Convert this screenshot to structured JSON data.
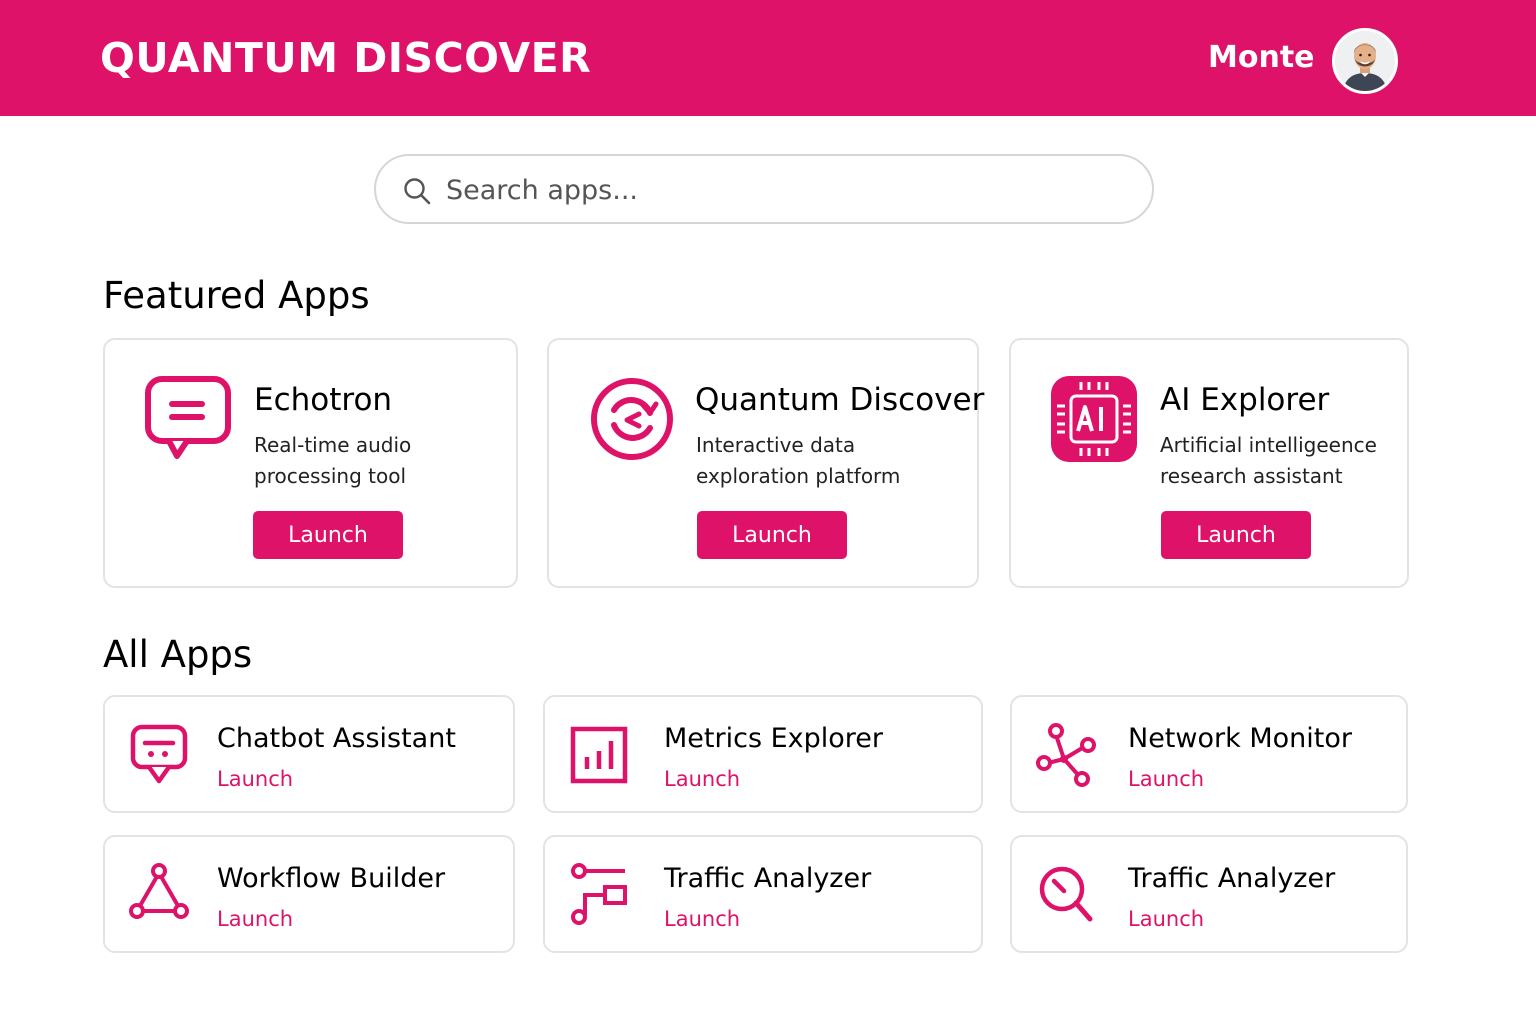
{
  "header": {
    "brand": "QUANTUM DISCOVER",
    "user_name": "Monte",
    "accent_color": "#dd1268"
  },
  "search": {
    "placeholder": "Search apps..."
  },
  "featured": {
    "title": "Featured Apps",
    "apps": [
      {
        "name": "Echotron",
        "desc_line1": "Real-time audio",
        "desc_line2": "processing tool",
        "button": "Launch",
        "icon": "chat-bubble-icon"
      },
      {
        "name": "Quantum Discover",
        "desc_line1": "Interactive data",
        "desc_line2": "exploration platform",
        "button": "Launch",
        "icon": "refresh-cycle-icon"
      },
      {
        "name": "AI Explorer",
        "desc_line1": "Artificial intelligeence",
        "desc_line2": "research assistant",
        "button": "Launch",
        "icon": "ai-chip-icon"
      }
    ]
  },
  "all_apps": {
    "title": "All Apps",
    "apps": [
      {
        "name": "Chatbot Assistant",
        "launch": "Launch",
        "icon": "chatbot-icon"
      },
      {
        "name": "Metrics Explorer",
        "launch": "Launch",
        "icon": "bar-chart-icon"
      },
      {
        "name": "Network Monitor",
        "launch": "Launch",
        "icon": "network-nodes-icon"
      },
      {
        "name": "Workflow Builder",
        "launch": "Launch",
        "icon": "workflow-triangle-icon"
      },
      {
        "name": "Traffic Analyzer",
        "launch": "Launch",
        "icon": "flow-connector-icon"
      },
      {
        "name": "Traffic Analyzer",
        "launch": "Launch",
        "icon": "magnifier-icon"
      }
    ]
  }
}
